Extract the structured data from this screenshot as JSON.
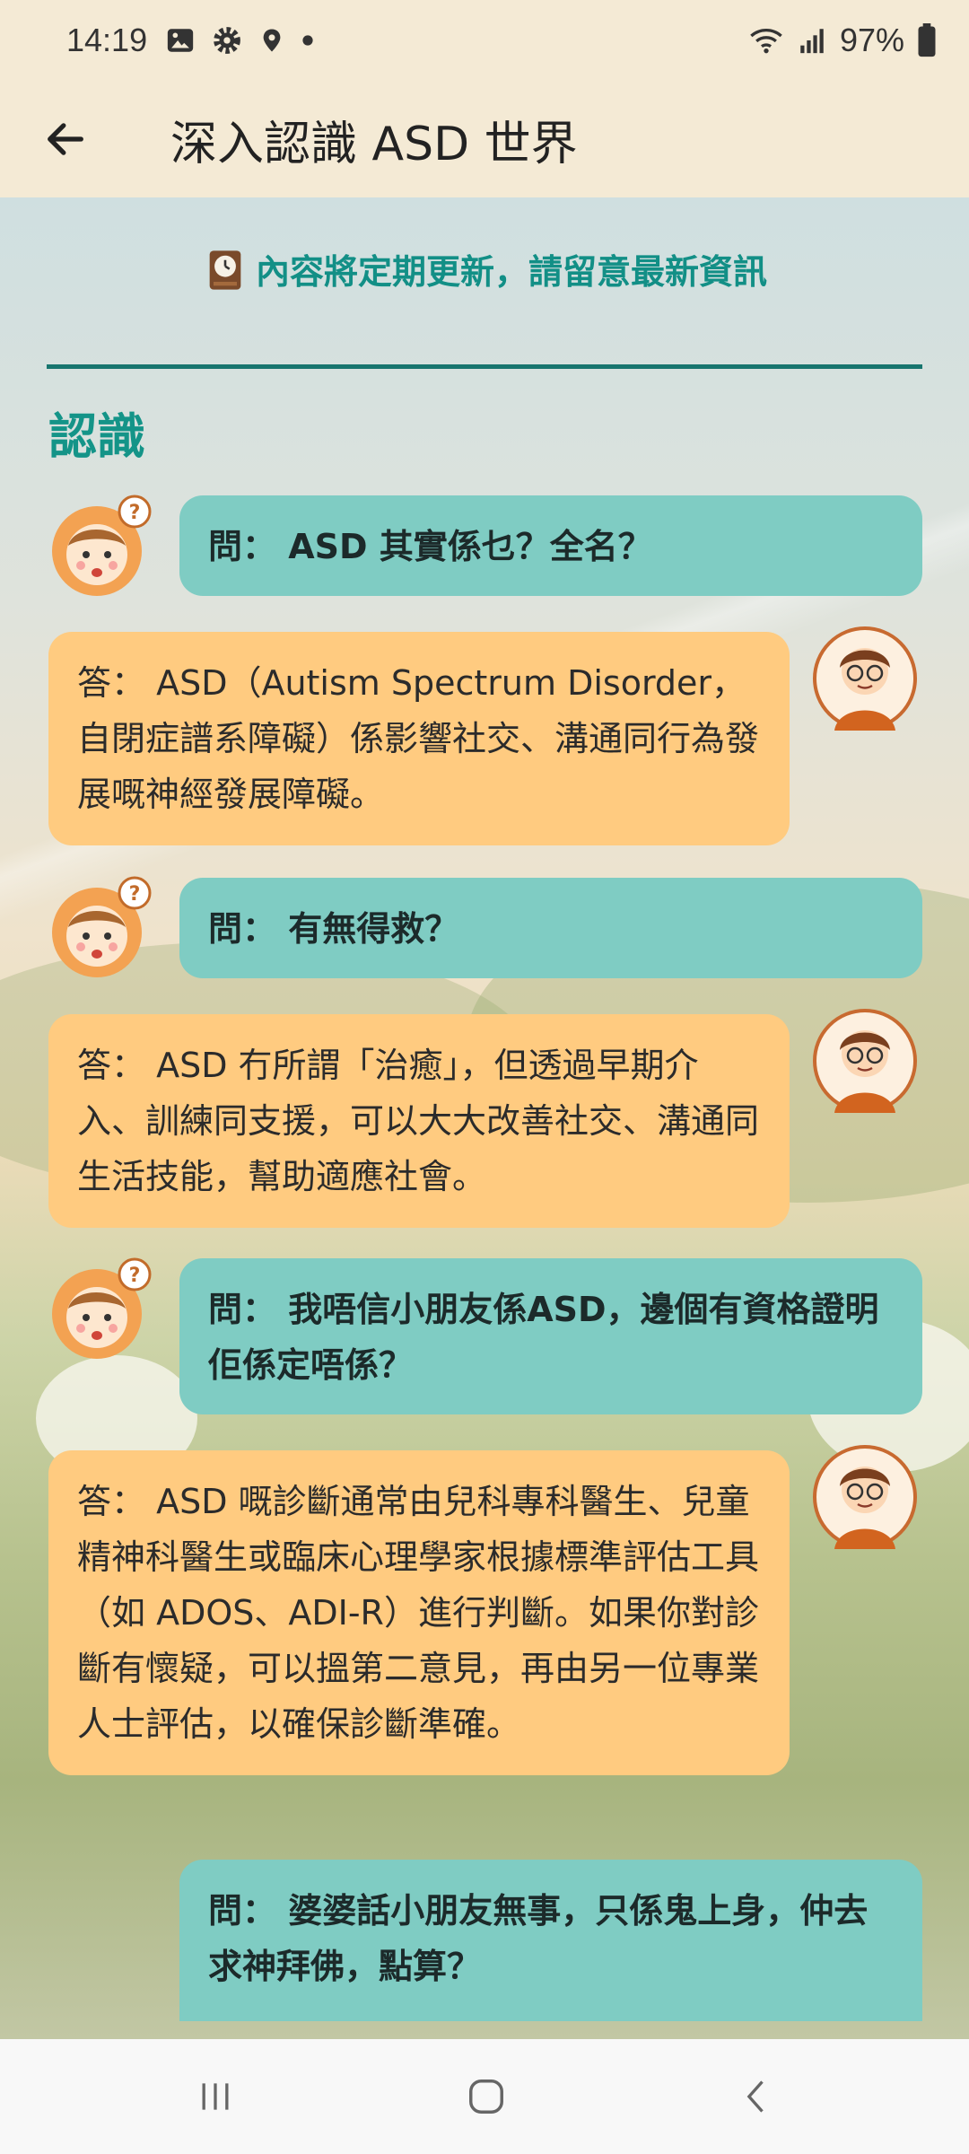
{
  "status_bar": {
    "time": "14:19",
    "battery": "97%"
  },
  "app_bar": {
    "title": "深入認識 ASD 世界"
  },
  "notice": {
    "text": "內容將定期更新，請留意最新資訊"
  },
  "section": {
    "title": "認識"
  },
  "qa": [
    {
      "q": "問： ASD 其實係乜？全名？",
      "a": "答： ASD（Autism Spectrum Disorder，自閉症譜系障礙）係影響社交、溝通同行為發展嘅神經發展障礙。"
    },
    {
      "q": "問： 有無得救？",
      "a": "答： ASD 冇所謂「治癒」，但透過早期介入、訓練同支援，可以大大改善社交、溝通同生活技能，幫助適應社會。"
    },
    {
      "q": "問： 我唔信小朋友係ASD，邊個有資格證明佢係定唔係？",
      "a": "答： ASD 嘅診斷通常由兒科專科醫生、兒童精神科醫生或臨床心理學家根據標準評估工具（如 ADOS、ADI-R）進行判斷。如果你對診斷有懷疑，可以搵第二意見，再由另一位專業人士評估，以確保診斷準確。"
    },
    {
      "q": "問： 婆婆話小朋友無事，只係鬼上身，仲去求神拜佛，點算？"
    }
  ],
  "icons": {
    "back": "arrow-left-icon",
    "clock": "clock-icon",
    "child": "child-question-avatar-icon",
    "expert": "doctor-avatar-icon",
    "recents": "recents-icon",
    "home": "home-icon",
    "nav_back": "chevron-left-icon"
  },
  "colors": {
    "question_bubble": "#7fccc3",
    "answer_bubble": "#ffcb80",
    "accent": "#149488",
    "divider": "#17756e"
  }
}
